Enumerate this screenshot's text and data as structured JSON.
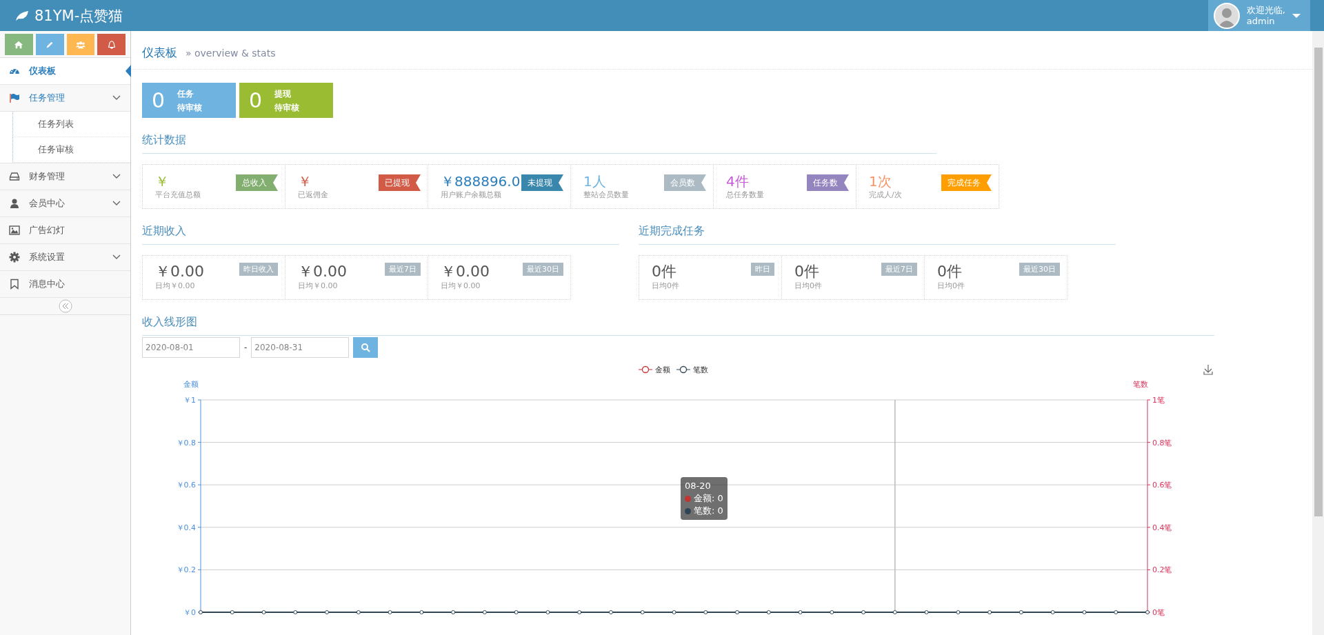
{
  "header": {
    "brand": "81YM-点赞猫",
    "user": {
      "greeting": "欢迎光临,",
      "name": "admin"
    }
  },
  "sidebar": {
    "shortcuts": [
      {
        "kind": "home",
        "color": "#87b87f"
      },
      {
        "kind": "pencil",
        "color": "#6fb3e0"
      },
      {
        "kind": "users",
        "color": "#ffb752"
      },
      {
        "kind": "bell",
        "color": "#d15b47"
      }
    ],
    "items": [
      {
        "label": "仪表板",
        "kind": "link",
        "selected": true
      },
      {
        "label": "任务管理",
        "kind": "group",
        "selected": false,
        "expanded": true,
        "children": [
          {
            "label": "任务列表"
          },
          {
            "label": "任务审核"
          }
        ]
      },
      {
        "label": "财务管理",
        "kind": "group",
        "selected": false
      },
      {
        "label": "会员中心",
        "kind": "group",
        "selected": false
      },
      {
        "label": "广告幻灯",
        "kind": "link",
        "selected": false
      },
      {
        "label": "系统设置",
        "kind": "group",
        "selected": false
      },
      {
        "label": "消息中心",
        "kind": "link",
        "selected": false
      }
    ]
  },
  "breadcrumb": {
    "title": "仪表板",
    "subtitle": "» overview & stats"
  },
  "pending": [
    {
      "count": "0",
      "label": "任务",
      "sublabel": "待审核",
      "color": "#6fb3e0"
    },
    {
      "count": "0",
      "label": "提现",
      "sublabel": "待审核",
      "color": "#9abc32"
    }
  ],
  "stats": {
    "title": "统计数据",
    "cards": [
      {
        "value": "￥",
        "caption": "平台充值总额",
        "badge": "总收入",
        "color": "#82af6f"
      },
      {
        "value": "￥",
        "caption": "已返佣金",
        "badge": "已提现",
        "color": "#d15b47"
      },
      {
        "value": "￥888896.0",
        "caption": "用户账户余额总额",
        "badge": "未提现",
        "color": "#3a87ad"
      },
      {
        "value": "1人",
        "caption": "整站会员数量",
        "badge": "会员数",
        "color": "#abbac3"
      },
      {
        "value": "4件",
        "caption": "总任务数量",
        "badge": "任务数",
        "color": "#9585bf"
      },
      {
        "value": "1次",
        "caption": "完成人/次",
        "badge": "完成任务",
        "color": "#ff9e00"
      }
    ]
  },
  "recent_income": {
    "title": "近期收入",
    "cards": [
      {
        "value": "￥0.00",
        "caption": "日均￥0.00",
        "badge": "昨日收入"
      },
      {
        "value": "￥0.00",
        "caption": "日均￥0.00",
        "badge": "最近7日"
      },
      {
        "value": "￥0.00",
        "caption": "日均￥0.00",
        "badge": "最近30日"
      }
    ]
  },
  "recent_tasks": {
    "title": "近期完成任务",
    "cards": [
      {
        "value": "0件",
        "caption": "日均0件",
        "badge": "昨日"
      },
      {
        "value": "0件",
        "caption": "日均0件",
        "badge": "最近7日"
      },
      {
        "value": "0件",
        "caption": "日均0件",
        "badge": "最近30日"
      }
    ]
  },
  "income_chart": {
    "title": "收入线形图",
    "date_from": "2020-08-01",
    "date_to": "2020-08-31",
    "separator": "-",
    "tooltip": {
      "title": "08-20",
      "rows": [
        {
          "label": "金额: 0",
          "color": "#c23531"
        },
        {
          "label": "笔数: 0",
          "color": "#2f4554"
        }
      ]
    },
    "chart_data": {
      "type": "line",
      "ylabel": "金额",
      "y2label": "笔数",
      "grid": true,
      "legend": true,
      "series": [
        {
          "name": "金额",
          "color": "#c23531",
          "marker": "circle",
          "values": [
            null,
            null,
            null,
            null,
            null,
            null,
            null,
            null,
            null,
            null,
            null,
            null,
            null,
            null,
            null,
            null,
            null,
            null,
            null,
            null,
            null,
            null,
            null,
            null,
            null,
            null,
            null,
            null,
            null,
            null,
            null
          ]
        },
        {
          "name": "笔数",
          "color": "#2f4554",
          "marker": "circle",
          "values": [
            0,
            0,
            0,
            0,
            0,
            0,
            0,
            0,
            0,
            0,
            0,
            0,
            0,
            0,
            0,
            0,
            0,
            0,
            0,
            0,
            0,
            0,
            0,
            0,
            0,
            0,
            0,
            0,
            0,
            0,
            0
          ]
        }
      ],
      "ylim": [
        0,
        1
      ],
      "y2lim": [
        0,
        1
      ],
      "yticks": [
        {
          "value": 0,
          "label": "￥0"
        },
        {
          "value": 0.2,
          "label": "￥0.2"
        },
        {
          "value": 0.4,
          "label": "￥0.4"
        },
        {
          "value": 0.6,
          "label": "￥0.6"
        },
        {
          "value": 0.8,
          "label": "￥0.8"
        },
        {
          "value": 1,
          "label": "￥1"
        }
      ],
      "y2ticks": [
        {
          "value": 0,
          "label": "0笔"
        },
        {
          "value": 0.2,
          "label": "0.2笔"
        },
        {
          "value": 0.4,
          "label": "0.4笔"
        },
        {
          "value": 0.6,
          "label": "0.6笔"
        },
        {
          "value": 0.8,
          "label": "0.8笔"
        },
        {
          "value": 1,
          "label": "1笔"
        }
      ]
    }
  }
}
